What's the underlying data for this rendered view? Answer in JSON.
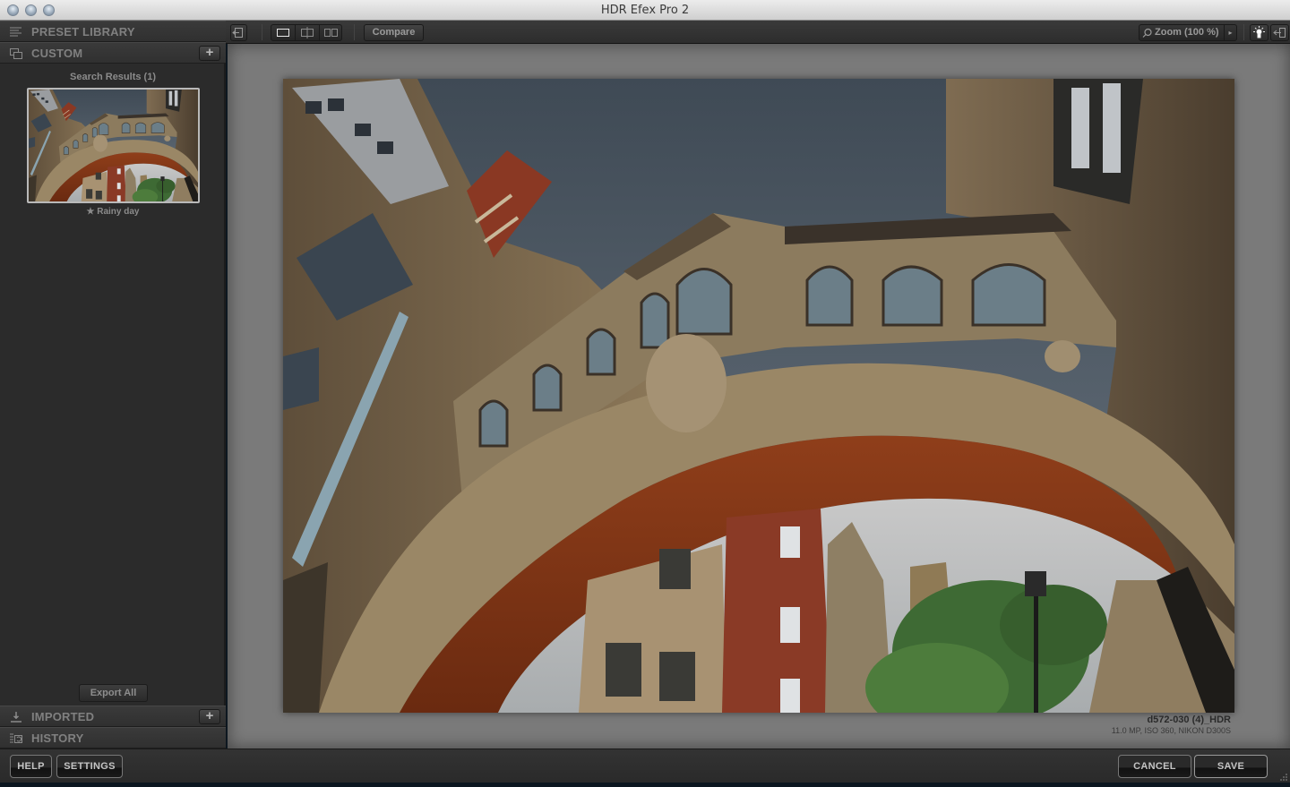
{
  "window": {
    "title": "HDR Efex Pro 2"
  },
  "sidebar": {
    "sections": [
      {
        "label": "PRESET LIBRARY",
        "icon": "list-icon"
      },
      {
        "label": "CUSTOM",
        "icon": "stacked-windows-icon",
        "has_add": true
      },
      {
        "label": "IMPORTED",
        "icon": "import-icon",
        "has_add": true
      },
      {
        "label": "HISTORY",
        "icon": "history-icon"
      }
    ],
    "add_label": "+",
    "search_results": "Search Results (1)",
    "preset": {
      "name": "Rainy day",
      "favorite_glyph": "★"
    },
    "export_all_label": "Export All"
  },
  "toolbar": {
    "exit_icon": "exit-panel-icon",
    "view_modes": [
      "single-view",
      "split-view",
      "side-by-side-view"
    ],
    "active_view": "single-view",
    "compare_label": "Compare",
    "zoom_label": "Zoom (100 %)",
    "zoom_arrow": "▸",
    "icons": [
      "loupe-brightness-icon",
      "collapse-panel-icon"
    ]
  },
  "photo": {
    "filename": "d572-030 (4)_HDR",
    "meta": "11.0 MP, ISO 360, NIKON D300S"
  },
  "footer": {
    "help_label": "HELP",
    "settings_label": "SETTINGS",
    "cancel_label": "CANCEL",
    "save_label": "SAVE"
  }
}
